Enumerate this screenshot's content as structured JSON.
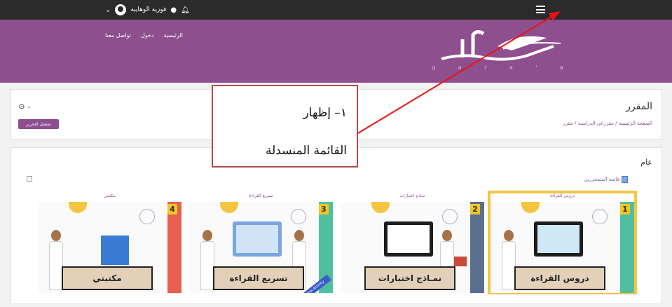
{
  "topbar": {
    "user_name": "فوزية الوهايبة",
    "icons": [
      "bell-icon",
      "chat-icon",
      "chevron-down-icon",
      "hamburger-menu-icon"
    ]
  },
  "header": {
    "nav": [
      "الرئيسية",
      "دخول",
      "تواصل معنا"
    ],
    "logo_letters": [
      "q",
      "a",
      "r",
      "a",
      "'",
      "a"
    ],
    "colors": {
      "brand": "#8e4f8e",
      "topbar": "#2b2b2b"
    }
  },
  "course_header": {
    "title": "المقرر",
    "breadcrumb": "الصفحة الرئيسية / مقرراتي الدراسية / مقرر",
    "edit_button": "تشغيل التحرير"
  },
  "section": {
    "title": "عام",
    "participants_link": "قائمة المتمحررين"
  },
  "tiles": [
    {
      "number": "1",
      "label": "دروس القراءة",
      "board": "دروس القراءة",
      "stripe": "#4fbf9f"
    },
    {
      "number": "2",
      "label": "نماذج اختبارات",
      "board": "نمـاذج اختبارات",
      "stripe": "#5a6f8f"
    },
    {
      "number": "3",
      "label": "تسريع القراءة",
      "board": "تسريع القراءة",
      "stripe": "#4fbf9f",
      "badge": "New Activity"
    },
    {
      "number": "4",
      "label": "مكتبتي",
      "board": "مكتبتي",
      "stripe": "#e85f4f"
    }
  ],
  "callout": {
    "line1": "١– إظهار",
    "line2": "القائمة المنسدلة"
  }
}
